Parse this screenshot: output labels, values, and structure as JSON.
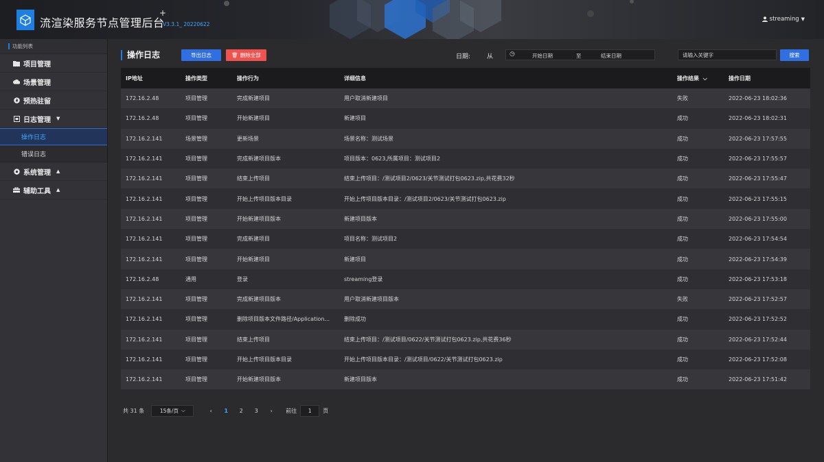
{
  "header": {
    "title": "流渲染服务节点管理后台",
    "plus": "+",
    "version": "V3.3.1_ 20220622",
    "user": "streaming"
  },
  "sidebar": {
    "caption": "功能列表",
    "items": [
      {
        "label": "项目管理",
        "icon": "folder-icon"
      },
      {
        "label": "场景管理",
        "icon": "cloud-icon"
      },
      {
        "label": "预热驻留",
        "icon": "flame-icon"
      },
      {
        "label": "日志管理",
        "icon": "log-icon",
        "caret": "▼"
      },
      {
        "label": "系统管理",
        "icon": "gear-icon",
        "caret": "▲"
      },
      {
        "label": "辅助工具",
        "icon": "toolbox-icon",
        "caret": "▲"
      }
    ],
    "sub_items": [
      {
        "label": "操作日志",
        "active": true
      },
      {
        "label": "错误日志",
        "active": false
      }
    ]
  },
  "toolbar": {
    "title": "操作日志",
    "export_label": "导出日志",
    "delete_label": "删除全部",
    "date_label": "日期:",
    "from_label": "从",
    "start_placeholder": "开始日期",
    "to_label": "至",
    "end_placeholder": "结束日期",
    "search_placeholder": "请输入关键字",
    "search_label": "搜索"
  },
  "table": {
    "columns": [
      "IP地址",
      "操作类型",
      "操作行为",
      "详细信息",
      "操作结果",
      "操作日期"
    ],
    "rows": [
      [
        "172.16.2.48",
        "项目管理",
        "完成新建项目",
        "用户取消新建项目",
        "失败",
        "2022-06-23 18:02:36"
      ],
      [
        "172.16.2.48",
        "项目管理",
        "开始新建项目",
        "新建项目",
        "成功",
        "2022-06-23 18:02:31"
      ],
      [
        "172.16.2.141",
        "场景管理",
        "更新场景",
        "场景名称：测试场景",
        "成功",
        "2022-06-23 17:57:55"
      ],
      [
        "172.16.2.141",
        "项目管理",
        "完成新建项目版本",
        "项目版本：0623,所属项目：测试项目2",
        "成功",
        "2022-06-23 17:55:57"
      ],
      [
        "172.16.2.141",
        "项目管理",
        "结束上传项目",
        "结束上传项目：/测试项目2/0623/关节测试打包0623.zip,共花费32秒",
        "成功",
        "2022-06-23 17:55:47"
      ],
      [
        "172.16.2.141",
        "项目管理",
        "开始上传项目版本目录",
        "开始上传项目版本目录：/测试项目2/0623/关节测试打包0623.zip",
        "成功",
        "2022-06-23 17:55:15"
      ],
      [
        "172.16.2.141",
        "项目管理",
        "开始新建项目版本",
        "新建项目版本",
        "成功",
        "2022-06-23 17:55:00"
      ],
      [
        "172.16.2.141",
        "项目管理",
        "完成新建项目",
        "项目名称：测试项目2",
        "成功",
        "2022-06-23 17:54:54"
      ],
      [
        "172.16.2.141",
        "项目管理",
        "开始新建项目",
        "新建项目",
        "成功",
        "2022-06-23 17:54:39"
      ],
      [
        "172.16.2.48",
        "通用",
        "登录",
        "streaming登录",
        "成功",
        "2022-06-23 17:53:18"
      ],
      [
        "172.16.2.141",
        "项目管理",
        "完成新建项目版本",
        "用户取消新建项目版本",
        "失败",
        "2022-06-23 17:52:57"
      ],
      [
        "172.16.2.141",
        "项目管理",
        "删除项目版本文件路径/Application...",
        "删除成功",
        "成功",
        "2022-06-23 17:52:52"
      ],
      [
        "172.16.2.141",
        "项目管理",
        "结束上传项目",
        "结束上传项目：/测试项目/0622/关节测试打包0623.zip,共花费36秒",
        "成功",
        "2022-06-23 17:52:44"
      ],
      [
        "172.16.2.141",
        "项目管理",
        "开始上传项目版本目录",
        "开始上传项目版本目录：/测试项目/0622/关节测试打包0623.zip",
        "成功",
        "2022-06-23 17:52:08"
      ],
      [
        "172.16.2.141",
        "项目管理",
        "开始新建项目版本",
        "新建项目版本",
        "成功",
        "2022-06-23 17:51:42"
      ]
    ]
  },
  "pagination": {
    "total": "共 31 条",
    "page_size": "15条/页",
    "prev": "‹",
    "pages": [
      "1",
      "2",
      "3"
    ],
    "current": "1",
    "next": "›",
    "goto_label": "前往",
    "goto_value": "1",
    "page_suffix": "页"
  },
  "colors": {
    "accent": "#2f6fe0",
    "danger": "#ef5350",
    "active_text": "#40a9ff"
  }
}
